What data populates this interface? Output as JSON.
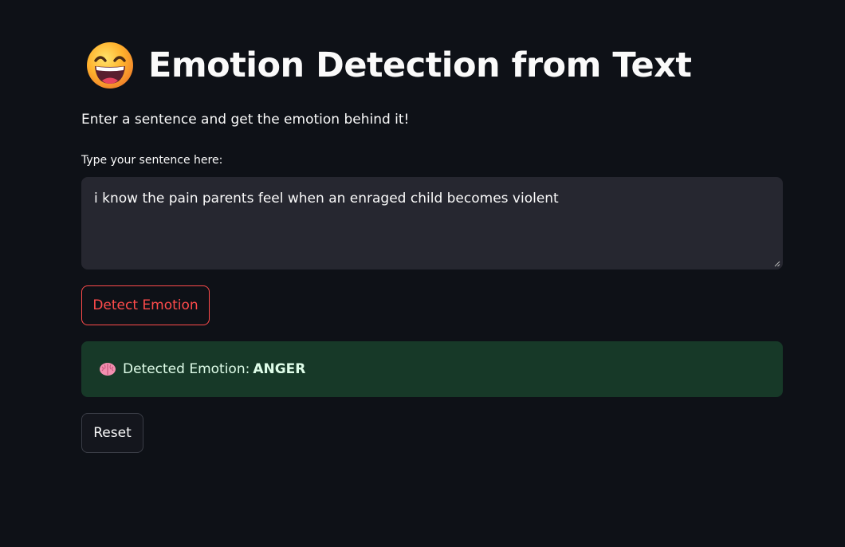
{
  "page": {
    "title": "Emotion Detection from Text",
    "title_icon": "grinning-face-emoji",
    "subtitle": "Enter a sentence and get the emotion behind it!"
  },
  "input": {
    "label": "Type your sentence here:",
    "value": "i know the pain parents feel when an enraged child becomes violent"
  },
  "actions": {
    "detect_label": "Detect Emotion",
    "reset_label": "Reset"
  },
  "result": {
    "icon": "brain-emoji",
    "prefix": "Detected Emotion:",
    "value": "ANGER"
  },
  "colors": {
    "background": "#0e1117",
    "input_background": "#262730",
    "accent": "#ff4b4b",
    "success_background": "#173928",
    "success_text": "#dffde9"
  }
}
